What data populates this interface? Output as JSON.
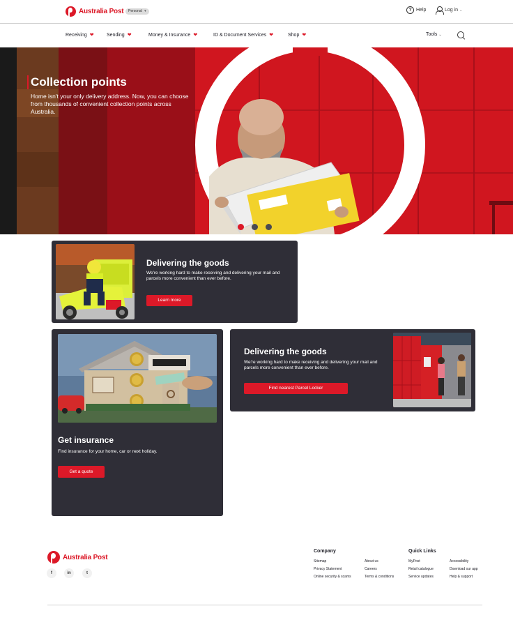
{
  "header": {
    "brand": "Australia Post",
    "segment": "Personal",
    "help": "Help",
    "login": "Log in"
  },
  "nav": {
    "items": [
      "Receiving",
      "Sending",
      "Money & Insurance",
      "ID & Document Services",
      "Shop"
    ],
    "tools": "Tools"
  },
  "hero": {
    "title": "Collection points",
    "description": "Home isn't your only delivery address. Now, you can choose from thousands of convenient collection points across Australia.",
    "active_slide": 1,
    "slide_count": 3
  },
  "cards": {
    "goods_1": {
      "title": "Delivering the goods",
      "body": "We're working hard to make receiving and delivering your mail and parcels more convenient than ever before.",
      "button": "Learn more"
    },
    "insurance": {
      "title": "Get insurance",
      "body": "Find insurance for your home, car or next holiday.",
      "button": "Get a quote"
    },
    "goods_2": {
      "title": "Delivering the goods",
      "body": "We're working hard to make receiving and delivering your mail and parcels more convenient than ever before.",
      "button": "Find nearest Parcel Locker"
    }
  },
  "footer": {
    "brand": "Australia Post",
    "social": [
      "f",
      "in",
      "t"
    ],
    "company": {
      "heading": "Company",
      "col1": [
        "Sitemap",
        "Privacy Statement",
        "Online security & scams"
      ],
      "col2": [
        "About us",
        "Careers",
        "Terms & conditions"
      ]
    },
    "quick_links": {
      "heading": "Quick Links",
      "col1": [
        "MyPost",
        "Retail catalogue",
        "Service updates"
      ],
      "col2": [
        "Accessibility",
        "Download our app",
        "Help & support"
      ]
    }
  },
  "colors": {
    "brand_red": "#dc1928",
    "card_bg": "#2f2e37"
  }
}
